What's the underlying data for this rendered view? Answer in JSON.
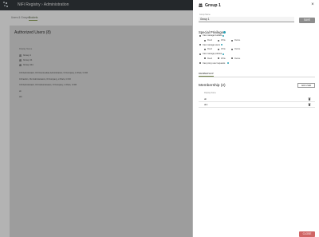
{
  "app": {
    "title": "NiFi Registry › Administration"
  },
  "background": {
    "tabs": [
      "Users & Groups",
      "Buckets"
    ],
    "panel_title": "Authorized Users (8)",
    "column_header": "Display Name",
    "users": [
      "Group 1",
      "Group 11",
      "Group 111"
    ],
    "long_rows": [
      "CN=Administrator, OU=Intermediate Administrators, O=Company, L=Paris, C=FR",
      "CN=admin, OU=Administrators, O=Company, L=Paris, C=FR",
      "CN=Administrator, OU=Administrators, O=Company, L=Paris, C=FR",
      "ab",
      "abc"
    ]
  },
  "dialog": {
    "title": "Group 1",
    "name_label": "Group Name",
    "name_value": "Group 1",
    "save_label": "SAVE",
    "special_privileges_title": "Special Privileges",
    "privileges": [
      {
        "label": "Can manage buckets",
        "subs": [
          "Read",
          "Write",
          "Delete"
        ]
      },
      {
        "label": "Can manage users",
        "subs": [
          "Read",
          "Write",
          "Delete"
        ]
      },
      {
        "label": "Can manage policies",
        "subs": [
          "Read",
          "Write",
          "Delete"
        ]
      },
      {
        "label": "Can proxy user requests",
        "subs": []
      }
    ],
    "membership_tab": "MEMBERSHIP",
    "membership_title": "Membership (2)",
    "add_user_label": "ADD USER",
    "display_name_header": "Display Name",
    "members": [
      "ab",
      "abc"
    ],
    "close_label": "CLOSE"
  },
  "colors": {
    "accent": "#29a0b5",
    "close": "#d06565",
    "topbar": "#2f3438",
    "tab_underline": "#6e7f45"
  }
}
